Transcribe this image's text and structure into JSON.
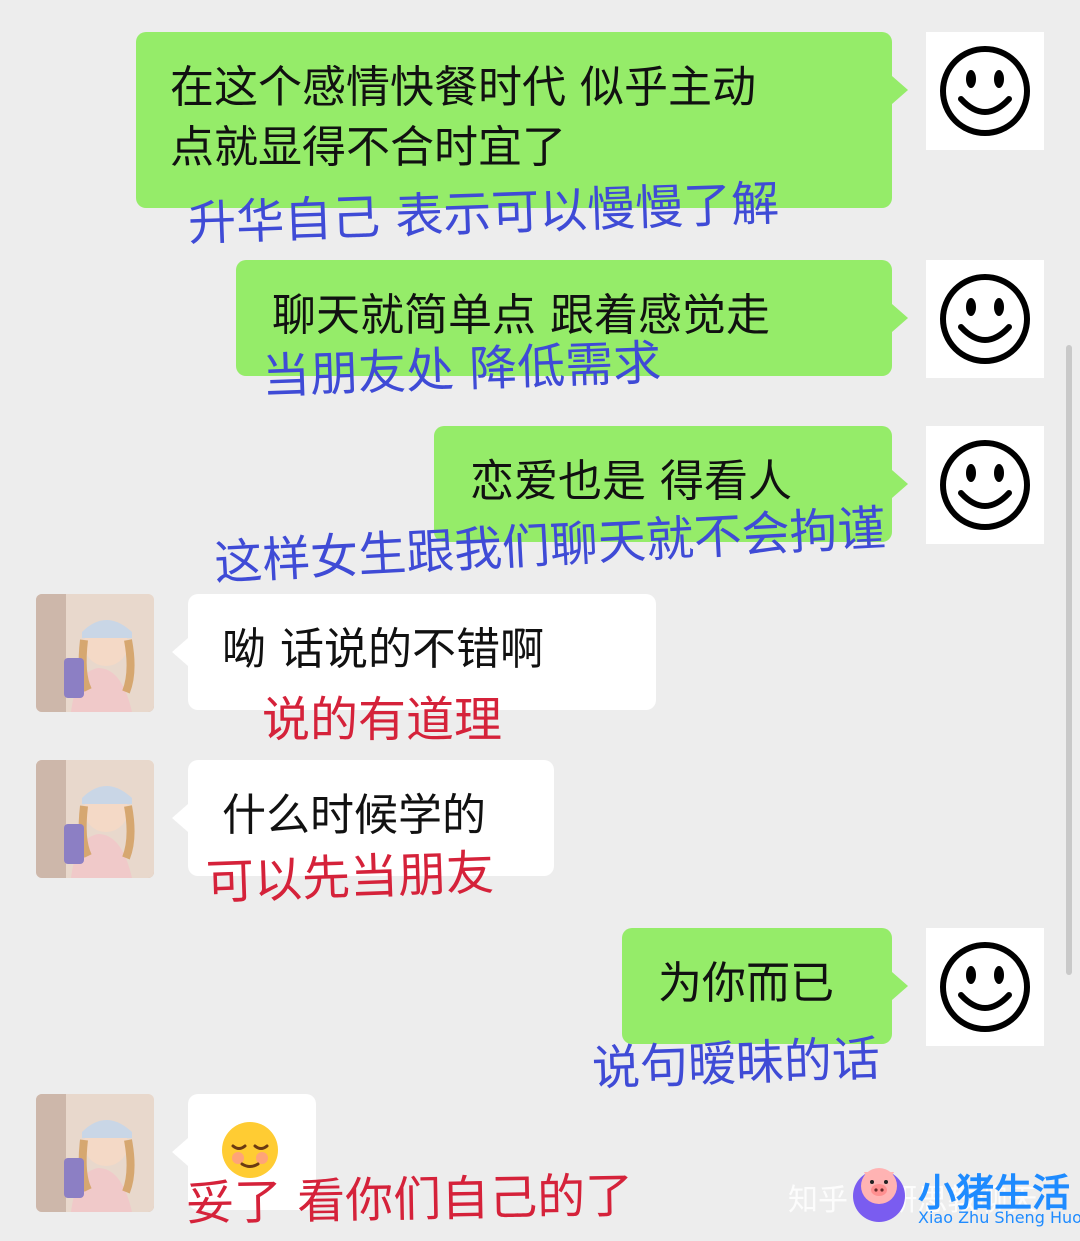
{
  "messages": [
    {
      "side": "right",
      "text_line1": "在这个感情快餐时代   似乎主动",
      "text_line2": "点就显得不合时宜了",
      "note": "升华自己   表示可以慢慢了解"
    },
    {
      "side": "right",
      "text": "聊天就简单点   跟着感觉走",
      "note": "当朋友处   降低需求"
    },
    {
      "side": "right",
      "text": "恋爱也是   得看人",
      "note": "这样女生跟我们聊天就不会拘谨"
    },
    {
      "side": "left",
      "text": "呦    话说的不错啊",
      "note": "说的有道理"
    },
    {
      "side": "left",
      "text": "什么时候学的",
      "note": "可以先当朋友"
    },
    {
      "side": "right",
      "text": "为你而已",
      "note": "说句暧昧的话"
    },
    {
      "side": "left",
      "emoji": "😌",
      "note": "妥了   看你们自己的了"
    }
  ],
  "watermark": {
    "text": "知乎 @研思教聊天"
  },
  "brand": {
    "name": "小猪生活",
    "subtitle": "Xiao Zhu Sheng Huo"
  },
  "colors": {
    "right_bubble": "#95ec69",
    "left_bubble": "#ffffff",
    "background": "#ededed",
    "note_blue": "#3f4bd6",
    "note_red": "#d5223a"
  },
  "icons": {
    "my_avatar": "smiley-face-icon",
    "her_avatar": "girl-photo-avatar"
  }
}
